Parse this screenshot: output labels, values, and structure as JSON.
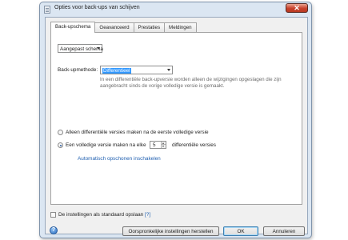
{
  "window": {
    "title": "Opties voor back-ups van schijven",
    "close_glyph": "✕"
  },
  "tabs": [
    {
      "label": "Back-upschema",
      "active": true
    },
    {
      "label": "Geavanceerd",
      "active": false
    },
    {
      "label": "Prestaties",
      "active": false
    },
    {
      "label": "Meldingen",
      "active": false
    }
  ],
  "schema": {
    "schedule_select": {
      "value": "Aangepast schema"
    },
    "method_label": "Back-upmethode:",
    "method_select": {
      "value": "Differentieel"
    },
    "method_description": "In een differentiële back-upversie worden alleen de wijzigingen opgeslagen die zijn aangebracht sinds de vorige volledige versie is gemaakt.",
    "option_only_differential": {
      "label": "Alleen differentiële versies maken na de eerste volledige versie",
      "selected": false
    },
    "option_full_every": {
      "label_before": "Een volledige versie maken na elke",
      "count": "5",
      "label_after": "differentiële versies",
      "selected": true
    },
    "auto_cleanup_link": "Automatisch opschonen inschakelen"
  },
  "footer": {
    "save_default_label": "De instellingen als standaard opslaan",
    "save_default_checked": false,
    "help_link": "[?]",
    "help_icon_glyph": "?",
    "reset_button": "Oorspronkelijke instellingen herstellen",
    "ok_button": "OK",
    "cancel_button": "Annuleren"
  }
}
